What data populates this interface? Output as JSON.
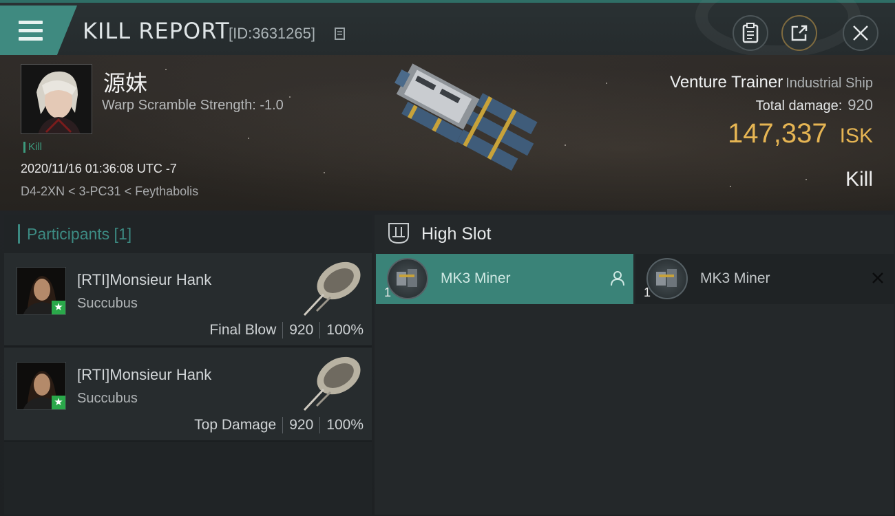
{
  "header": {
    "title": "KILL REPORT",
    "report_id": "[ID:3631265]"
  },
  "victim": {
    "name": "源妹",
    "warp_scramble": "Warp Scramble Strength: -1.0",
    "kill_tag": "Kill",
    "time": "2020/11/16 01:36:08 UTC -7",
    "location": "D4-2XN < 3-PC31 < Feythabolis",
    "ship_name": "Venture Trainer",
    "ship_class": "Industrial Ship",
    "total_damage_label": "Total damage:",
    "total_damage": "920",
    "isk_value": "147,337",
    "isk_unit": "ISK",
    "kill_type": "Kill"
  },
  "participants": {
    "header": "Participants [1]",
    "rows": [
      {
        "name": "[RTI]Monsieur Hank",
        "ship": "Succubus",
        "role": "Final Blow",
        "damage": "920",
        "percent": "100%"
      },
      {
        "name": "[RTI]Monsieur Hank",
        "ship": "Succubus",
        "role": "Top Damage",
        "damage": "920",
        "percent": "100%"
      }
    ]
  },
  "slots": {
    "title": "High Slot",
    "modules": [
      {
        "name": "MK3 Miner",
        "qty": "1"
      },
      {
        "name": "MK3 Miner",
        "qty": "1"
      }
    ]
  },
  "colors": {
    "accent": "#3f8a80",
    "isk": "#e6b553",
    "badge": "#2aa84a"
  }
}
